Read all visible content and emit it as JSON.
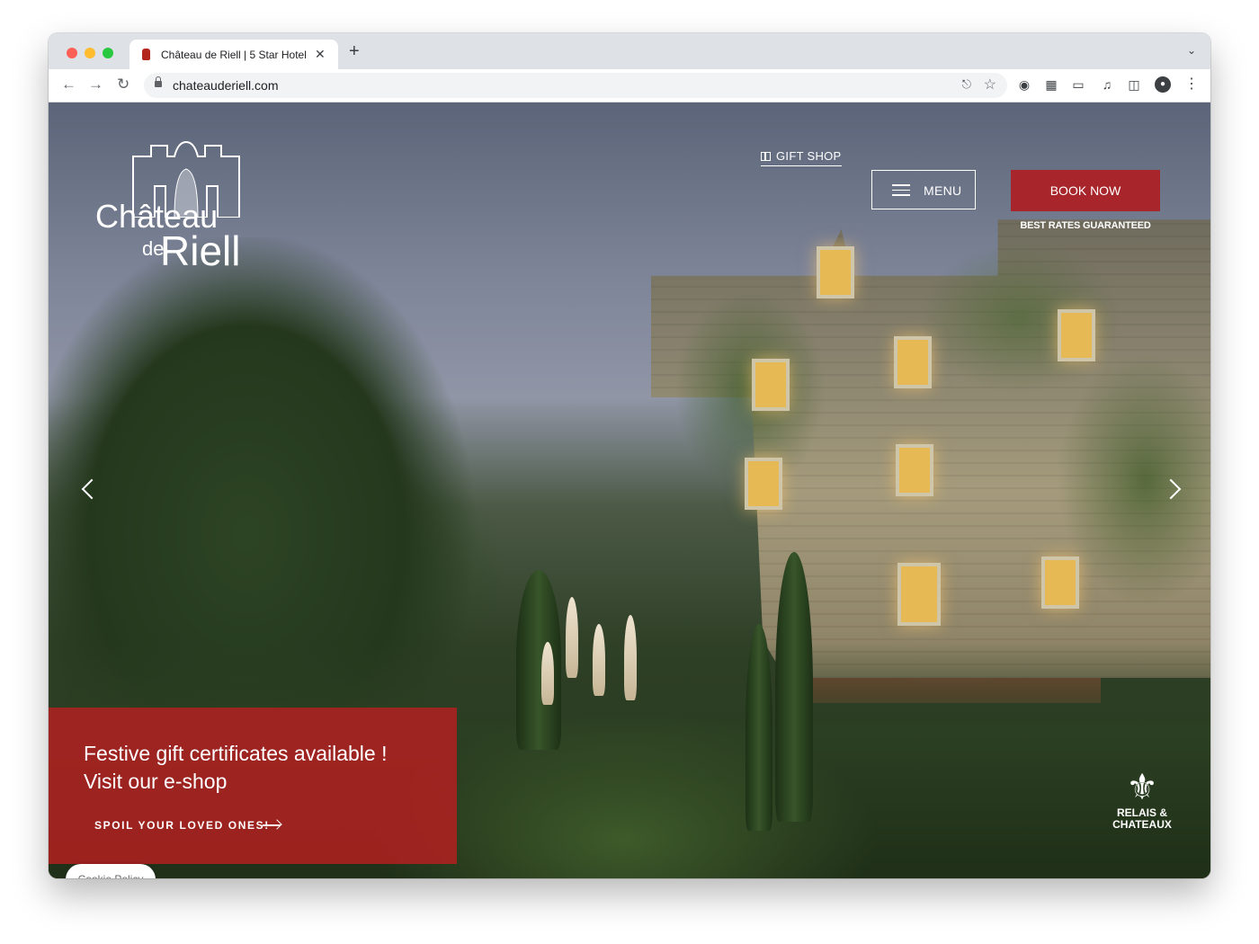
{
  "browser": {
    "tab_title": "Château de Riell | 5 Star Hotel",
    "tab_close": "✕",
    "new_tab": "+",
    "url": "chateauderiell.com",
    "icons": [
      "back-icon",
      "forward-icon",
      "reload-icon",
      "lock-icon",
      "share-icon",
      "star-icon",
      "extension-icon",
      "puzzle-icon",
      "cast-icon",
      "media-icon",
      "sidepanel-icon",
      "profile-icon",
      "kebab-menu-icon"
    ]
  },
  "site": {
    "logo": {
      "word1": "Château",
      "word2": "de",
      "word3": "Riell"
    },
    "nav": {
      "gift_shop": "GIFT SHOP",
      "menu": "MENU",
      "book_now": "BOOK NOW",
      "rates_note": "BEST RATES GUARANTEED"
    },
    "promo": {
      "line1": "Festive gift certificates available !",
      "line2": "Visit our e-shop",
      "cta": "SPOIL YOUR LOVED ONES!"
    },
    "cookie": "Cookie Policy",
    "badge": {
      "line1": "RELAIS &",
      "line2": "CHATEAUX"
    }
  },
  "colors": {
    "brand_red": "#a8252b",
    "promo_red": "#b22020"
  }
}
